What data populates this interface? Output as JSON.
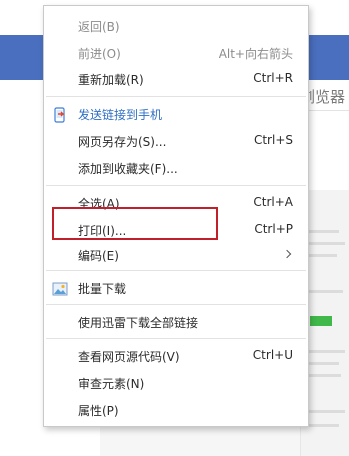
{
  "background": {
    "title_fragment": "浏览器"
  },
  "menu": {
    "items": [
      {
        "label": "返回(B)",
        "shortcut": "",
        "enabled": false
      },
      {
        "label": "前进(O)",
        "shortcut": "Alt+向右箭头",
        "enabled": false
      },
      {
        "label": "重新加载(R)",
        "shortcut": "Ctrl+R",
        "enabled": true
      },
      {
        "label": "发送链接到手机",
        "shortcut": "",
        "enabled": true,
        "icon": "phone-send-icon"
      },
      {
        "label": "网页另存为(S)...",
        "shortcut": "Ctrl+S",
        "enabled": true
      },
      {
        "label": "添加到收藏夹(F)...",
        "shortcut": "",
        "enabled": true
      },
      {
        "label": "全选(A)",
        "shortcut": "Ctrl+A",
        "enabled": true
      },
      {
        "label": "打印(I)...",
        "shortcut": "Ctrl+P",
        "enabled": true
      },
      {
        "label": "编码(E)",
        "shortcut": "",
        "enabled": true,
        "submenu": true
      },
      {
        "label": "批量下载",
        "shortcut": "",
        "enabled": true,
        "icon": "image-download-icon"
      },
      {
        "label": "使用迅雷下载全部链接",
        "shortcut": "",
        "enabled": true
      },
      {
        "label": "查看网页源代码(V)",
        "shortcut": "Ctrl+U",
        "enabled": true
      },
      {
        "label": "审查元素(N)",
        "shortcut": "",
        "enabled": true
      },
      {
        "label": "属性(P)",
        "shortcut": "",
        "enabled": true
      }
    ]
  },
  "colors": {
    "highlight_border": "#c0202a",
    "link_text": "#2f6fc4",
    "background_bar": "#4a6fbf"
  }
}
